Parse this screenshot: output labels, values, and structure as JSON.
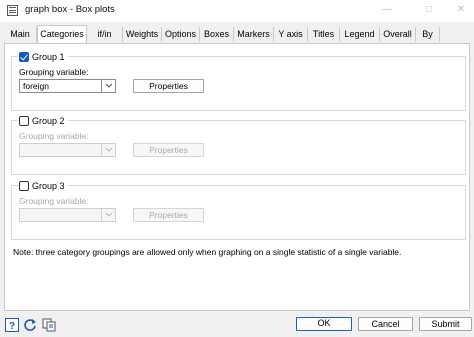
{
  "window": {
    "title": "graph box - Box plots"
  },
  "tabs": [
    {
      "label": "Main"
    },
    {
      "label": "Categories"
    },
    {
      "label": "if/in"
    },
    {
      "label": "Weights"
    },
    {
      "label": "Options"
    },
    {
      "label": "Boxes"
    },
    {
      "label": "Markers"
    },
    {
      "label": "Y axis"
    },
    {
      "label": "Titles"
    },
    {
      "label": "Legend"
    },
    {
      "label": "Overall"
    },
    {
      "label": "By"
    }
  ],
  "active_tab": "Categories",
  "groups": [
    {
      "label": "Group 1",
      "checked": true,
      "field_label": "Grouping variable:",
      "value": "foreign",
      "properties_label": "Properties"
    },
    {
      "label": "Group 2",
      "checked": false,
      "field_label": "Grouping variable:",
      "value": "",
      "properties_label": "Properties"
    },
    {
      "label": "Group 3",
      "checked": false,
      "field_label": "Grouping variable:",
      "value": "",
      "properties_label": "Properties"
    }
  ],
  "note": "Note: three category groupings are allowed only when graphing on a single statistic of a single variable.",
  "footer": {
    "icons": [
      "help-icon",
      "reset-icon",
      "copy-icon"
    ],
    "ok_label": "OK",
    "cancel_label": "Cancel",
    "submit_label": "Submit"
  },
  "colors": {
    "accent": "#0f5bd3",
    "default_button_border": "#1a5fc6"
  }
}
